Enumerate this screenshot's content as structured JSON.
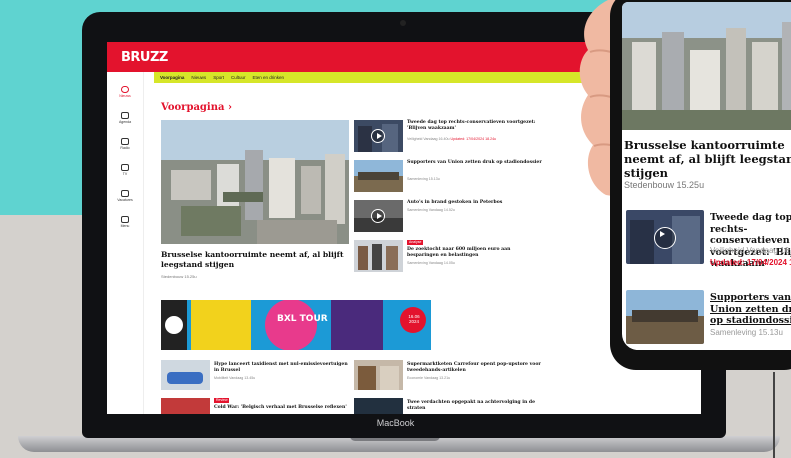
{
  "colors": {
    "brand_red": "#e3132d",
    "accent_yellow": "#d6e629",
    "teal": "#5fd3d0"
  },
  "laptop": {
    "brand": "MacBook"
  },
  "site": {
    "logo": "BRUZZ",
    "subnav": [
      "Voorpagina",
      "Nieuws",
      "Sport",
      "Cultuur",
      "Eten en drinken"
    ],
    "sidebar": [
      {
        "label": "Nieuws",
        "icon": "home-icon"
      },
      {
        "label": "Agenda",
        "icon": "calendar-icon"
      },
      {
        "label": "Radio",
        "icon": "radio-icon"
      },
      {
        "label": "TV",
        "icon": "tv-icon"
      },
      {
        "label": "Vacatures",
        "icon": "jobs-icon"
      },
      {
        "label": "Menu",
        "icon": "menu-icon"
      }
    ],
    "section_title": "Voorpagina",
    "hero": {
      "title": "Brusselse kantoorruimte neemt af, al blijft leegstand stijgen",
      "meta": "Stedenbouw 15.25u"
    },
    "articles": [
      {
        "title": "Tweede dag top rechts-conservatieven voortgezet: 'Blijven waakzaam'",
        "meta": "Veiligheid Vandaag 16.40u",
        "updated": "Updated: 17/04/2024 18.24u"
      },
      {
        "title": "Supporters van Union zetten druk op stadiondossier",
        "meta": "Samenleving 15.13u"
      },
      {
        "title": "Auto's in brand gestoken in Peterbos",
        "meta": "Samenleving Vandaag 14.52u"
      },
      {
        "title": "De zoektocht naar 600 miljoen euro aan besparingen en belastingen",
        "meta": "Samenleving Vandaag 14.05u",
        "badge": "Analyse"
      }
    ],
    "banner": {
      "title": "BXL TOUR",
      "date": "16.06 2024"
    },
    "mini_articles": [
      {
        "title": "Hype lanceert taxidienst met nul-emissievoertuigen in Brussel",
        "meta": "Mobiliteit Vandaag 13.45u"
      },
      {
        "title": "Supermarktketen Carrefour opent pop-upstore voor tweedehands-artikelen",
        "meta": "Economie Vandaag 13.21u"
      },
      {
        "title": "Cold War: 'Belgisch verhaal met Brusselse reflexen'",
        "meta": "Cultuur Vandaag 12.58u",
        "badge": "Review"
      },
      {
        "title": "Twee verdachten opgepakt na achtervolging in de straten",
        "meta": "Veiligheid Vandaag 12.40u"
      }
    ]
  },
  "phone": {
    "hero": {
      "title": "Brusselse kantoorruimte neemt af, al blijft leegstand stijgen",
      "meta": "Stedenbouw 15.25u"
    },
    "articles": [
      {
        "title": "Tweede dag top rechts-conservatieven voortgezet: 'Blijven waakzaam'",
        "meta": "Veiligheid Vandaag 16.40u",
        "updated": "Updated: 17/04/2024 18.24u"
      },
      {
        "title": "Supporters van Union zetten druk op stadiondossier",
        "meta": "Samenleving 15.13u"
      }
    ]
  }
}
